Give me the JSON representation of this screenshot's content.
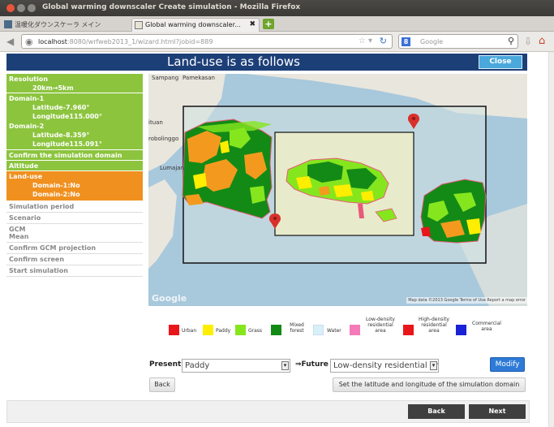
{
  "window": {
    "title": "Global warming downscaler Create simulation - Mozilla Firefox"
  },
  "tabs": [
    {
      "label": "温暖化ダウンスケーラ メイン"
    },
    {
      "label": "Global warming downscaler..."
    }
  ],
  "nav": {
    "url_host": "localhost",
    "url_rest": ":8080/wrfweb2013_1/wizard.html?jobid=889",
    "search_placeholder": "Google"
  },
  "header": {
    "title": "Land-use is as follows",
    "close_label": "Close"
  },
  "sidebar": {
    "resolution": {
      "heading": "Resolution",
      "value": "20km→5km"
    },
    "domain1": {
      "heading": "Domain-1",
      "lat": "Latitude-7.960°",
      "lon": "Longitude115.000°"
    },
    "domain2": {
      "heading": "Domain-2",
      "lat": "Latitude-8.359°",
      "lon": "Longitude115.091°"
    },
    "confirm_domain": "Confirm the simulation domain",
    "altitude": "Altitude",
    "landuse": {
      "heading": "Land-use",
      "d1": "Domain-1:No",
      "d2": "Domain-2:No"
    },
    "gray_items": [
      "Simulation period",
      "Scenario",
      "GCM",
      "Mean",
      "Confirm GCM projection",
      "Confirm screen",
      "Start simulation"
    ]
  },
  "map": {
    "labels": {
      "sampang": "Sampang",
      "pamekasan": "Pamekasan",
      "situbondo": "ituan",
      "probolinggo": "robolinggo",
      "lumajang": "Lumajan"
    },
    "google_logo": "Google",
    "footer": "Map data ©2013 Google   Terms of Use   Report a map error"
  },
  "legend": [
    {
      "label": "Urban",
      "color": "#e8161b"
    },
    {
      "label": "Paddy",
      "color": "#ffee00"
    },
    {
      "label": "Grass",
      "color": "#86e61e"
    },
    {
      "label": "Mixed forest",
      "color": "#138a16"
    },
    {
      "label": "Water",
      "color": "#d8f0fa"
    },
    {
      "label": "Low-density residential area",
      "color": "#f57ab8"
    },
    {
      "label": "High-density residential area",
      "color": "#e8161b"
    },
    {
      "label": "Commercial area",
      "color": "#1a22d6"
    }
  ],
  "controls": {
    "present_label": "Present:",
    "present_value": "Paddy",
    "future_label": "⇒Future",
    "future_value": "Low-density residential area",
    "modify_label": "Modify",
    "back_label": "Back",
    "set_domain_label": "Set the latitude and longitude of the simulation domain"
  },
  "footer": {
    "back_label": "Back",
    "next_label": "Next"
  }
}
